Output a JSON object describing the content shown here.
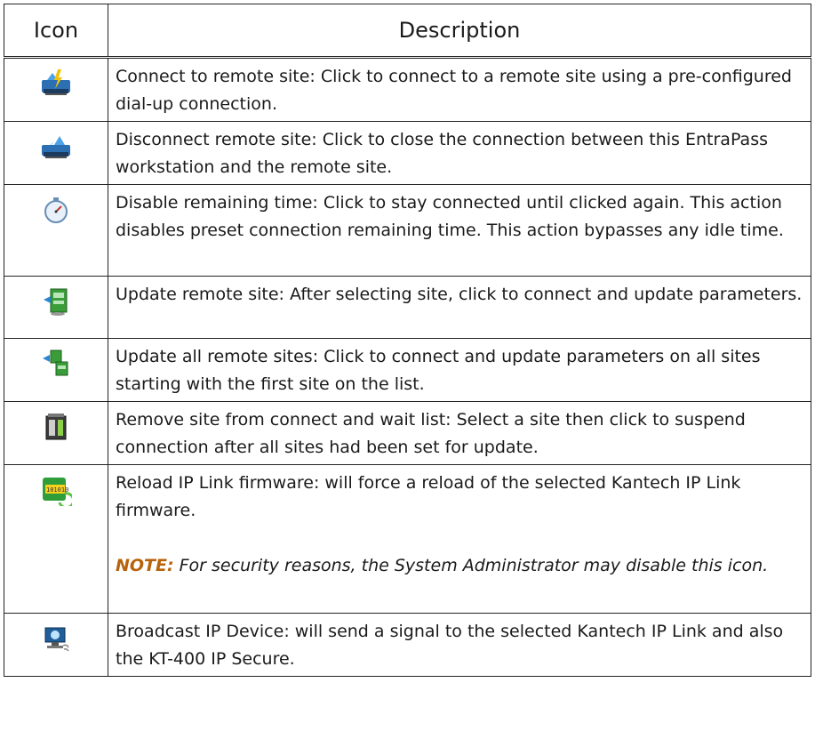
{
  "table": {
    "headers": {
      "icon": "Icon",
      "description": "Description"
    },
    "rows": [
      {
        "icon": "connect-remote-site-icon",
        "description": "Connect to remote site: Click to connect to a remote site using a pre-configured dial-up connection."
      },
      {
        "icon": "disconnect-remote-site-icon",
        "description": "Disconnect remote site: Click to close the connection between this EntraPass workstation and the remote site."
      },
      {
        "icon": "stopwatch-icon",
        "description": "Disable remaining time: Click to stay connected until clicked again. This action disables preset connection remaining time. This action bypasses any idle time."
      },
      {
        "icon": "update-remote-site-icon",
        "description": "Update remote site: After selecting site, click to connect and update parameters."
      },
      {
        "icon": "update-all-remote-sites-icon",
        "description": "Update all remote sites: Click to connect and update parameters on all sites starting with the first site on the list."
      },
      {
        "icon": "remove-site-icon",
        "description": "Remove site from connect and wait list: Select a site then click to suspend connection after all sites had been set for update."
      },
      {
        "icon": "reload-firmware-icon",
        "description": "Reload IP Link firmware: will force a reload of the selected Kantech IP Link firmware.",
        "note_label": "NOTE:",
        "note_text": " For security reasons, the System Administrator may disable this icon."
      },
      {
        "icon": "broadcast-ip-device-icon",
        "description": "Broadcast IP Device: will send a signal to the selected Kantech IP Link and also the KT-400 IP Secure."
      }
    ]
  }
}
